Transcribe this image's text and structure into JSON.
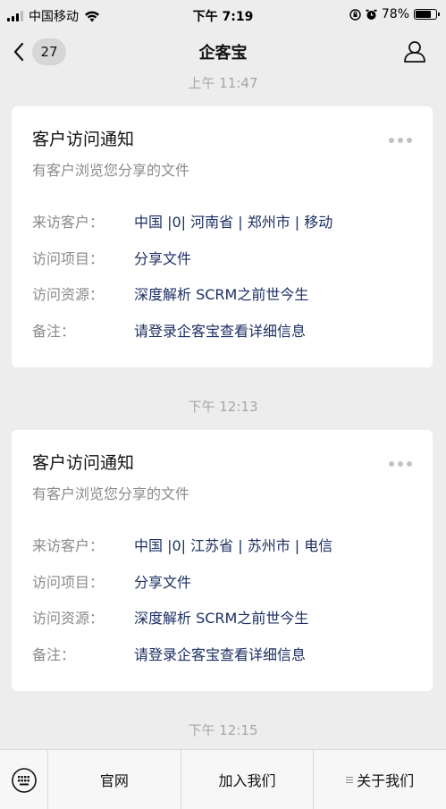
{
  "status_bar": {
    "carrier": "中国移动",
    "time": "下午 7:19",
    "battery_percent": "78%",
    "battery_level": 0.78
  },
  "nav": {
    "unread_count": "27",
    "title": "企客宝"
  },
  "messages": [
    {
      "time_before": "上午 11:47",
      "title": "客户访问通知",
      "subtitle": "有客户浏览您分享的文件",
      "rows": [
        {
          "label": "来访客户：",
          "value": "中国 |0| 河南省 | 郑州市 | 移动"
        },
        {
          "label": "访问项目：",
          "value": "分享文件"
        },
        {
          "label": "访问资源：",
          "value": "深度解析 SCRM之前世今生"
        },
        {
          "label": "备注：",
          "value": "请登录企客宝查看详细信息"
        }
      ]
    },
    {
      "time_before": "下午 12:13",
      "title": "客户访问通知",
      "subtitle": "有客户浏览您分享的文件",
      "rows": [
        {
          "label": "来访客户：",
          "value": "中国 |0| 江苏省 | 苏州市 | 电信"
        },
        {
          "label": "访问项目：",
          "value": "分享文件"
        },
        {
          "label": "访问资源：",
          "value": "深度解析 SCRM之前世今生"
        },
        {
          "label": "备注：",
          "value": "请登录企客宝查看详细信息"
        }
      ]
    }
  ],
  "last_time": "下午 12:15",
  "bottom_menu": {
    "items": [
      "官网",
      "加入我们",
      "关于我们"
    ]
  },
  "colors": {
    "background": "#ededed",
    "card": "#ffffff",
    "value_text": "#1c2f63",
    "label_text": "#8a8a8a"
  }
}
